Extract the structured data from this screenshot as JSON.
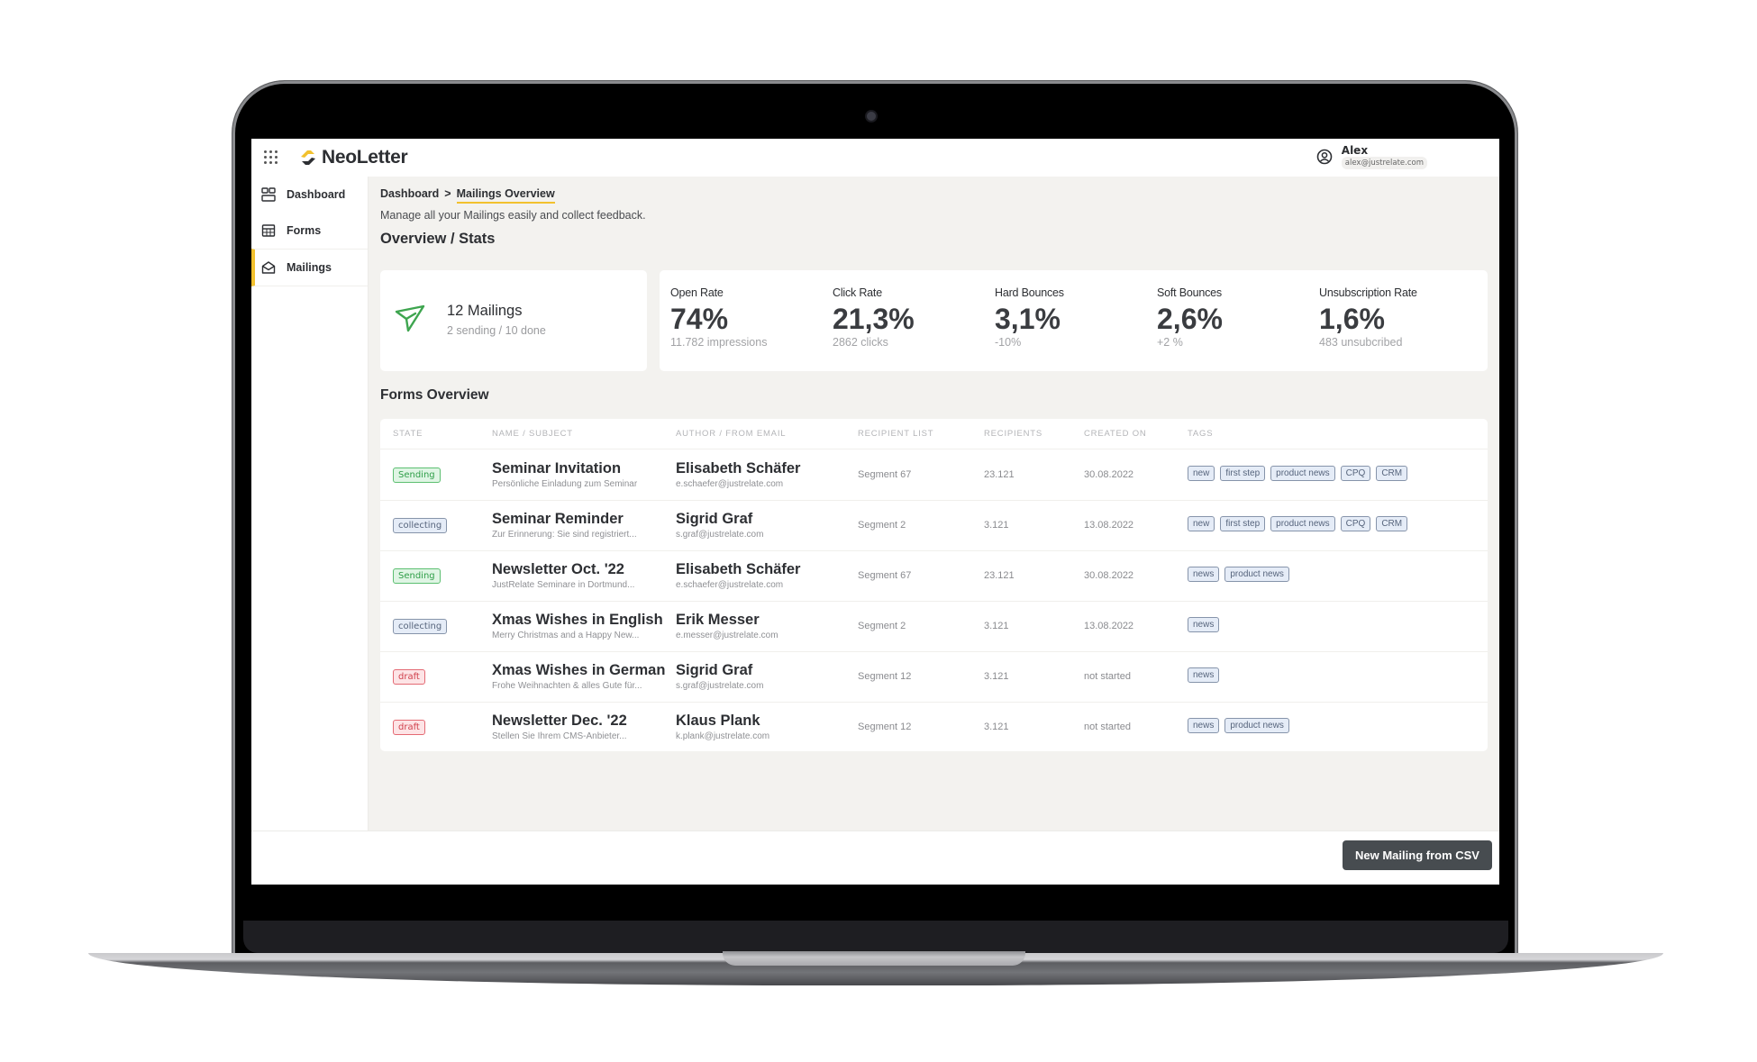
{
  "app": {
    "name": "NeoLetter",
    "brand_color": "#f2c12e"
  },
  "user": {
    "name": "Alex",
    "email": "alex@justrelate.com"
  },
  "sidebar": {
    "items": [
      {
        "label": "Dashboard",
        "icon": "dashboard-icon",
        "active": false
      },
      {
        "label": "Forms",
        "icon": "table-icon",
        "active": false
      },
      {
        "label": "Mailings",
        "icon": "envelope-open-icon",
        "active": true
      }
    ]
  },
  "breadcrumb": {
    "root": "Dashboard",
    "separator": ">",
    "current": "Mailings Overview"
  },
  "page": {
    "subtitle": "Manage all your Mailings easily and collect feedback."
  },
  "overview": {
    "heading": "Overview / Stats",
    "mailings": {
      "count_label": "12 Mailings",
      "status": "2 sending / 10 done"
    },
    "stats": [
      {
        "label": "Open Rate",
        "value": "74%",
        "sub": "11.782 impressions"
      },
      {
        "label": "Click Rate",
        "value": "21,3%",
        "sub": "2862 clicks"
      },
      {
        "label": "Hard Bounces",
        "value": "3,1%",
        "sub": "-10%"
      },
      {
        "label": "Soft Bounces",
        "value": "2,6%",
        "sub": "+2 %"
      },
      {
        "label": "Unsubscription Rate",
        "value": "1,6%",
        "sub": "483 unsubcribed"
      }
    ]
  },
  "forms": {
    "heading": "Forms Overview",
    "columns": [
      "STATE",
      "NAME / SUBJECT",
      "AUTHOR / FROM EMAIL",
      "RECIPIENT LIST",
      "RECIPIENTS",
      "CREATED ON",
      "TAGS"
    ],
    "rows": [
      {
        "state": "Sending",
        "state_type": "sending",
        "name": "Seminar Invitation",
        "subject": "Persönliche Einladung zum Seminar",
        "author": "Elisabeth Schäfer",
        "email": "e.schaefer@justrelate.com",
        "list": "Segment 67",
        "recipients": "23.121",
        "created": "30.08.2022",
        "tags": [
          "new",
          "first step",
          "product news",
          "CPQ",
          "CRM"
        ]
      },
      {
        "state": "collecting",
        "state_type": "collecting",
        "name": "Seminar Reminder",
        "subject": "Zur Erinnerung: Sie sind registriert...",
        "author": "Sigrid Graf",
        "email": "s.graf@justrelate.com",
        "list": "Segment 2",
        "recipients": "3.121",
        "created": "13.08.2022",
        "tags": [
          "new",
          "first step",
          "product news",
          "CPQ",
          "CRM"
        ]
      },
      {
        "state": "Sending",
        "state_type": "sending",
        "name": "Newsletter Oct. '22",
        "subject": "JustRelate Seminare in Dortmund...",
        "author": "Elisabeth Schäfer",
        "email": "e.schaefer@justrelate.com",
        "list": "Segment 67",
        "recipients": "23.121",
        "created": "30.08.2022",
        "tags": [
          "news",
          "product news"
        ]
      },
      {
        "state": "collecting",
        "state_type": "collecting",
        "name": "Xmas Wishes in English",
        "subject": "Merry Christmas and a Happy New...",
        "author": "Erik Messer",
        "email": "e.messer@justrelate.com",
        "list": "Segment 2",
        "recipients": "3.121",
        "created": "13.08.2022",
        "tags": [
          "news"
        ]
      },
      {
        "state": "draft",
        "state_type": "draft",
        "name": "Xmas Wishes in German",
        "subject": "Frohe Weihnachten & alles Gute für...",
        "author": "Sigrid Graf",
        "email": "s.graf@justrelate.com",
        "list": "Segment 12",
        "recipients": "3.121",
        "created": "not started",
        "tags": [
          "news"
        ]
      },
      {
        "state": "draft",
        "state_type": "draft",
        "name": "Newsletter Dec. '22",
        "subject": "Stellen Sie Ihrem CMS-Anbieter...",
        "author": "Klaus Plank",
        "email": "k.plank@justrelate.com",
        "list": "Segment 12",
        "recipients": "3.121",
        "created": "not started",
        "tags": [
          "news",
          "product news"
        ]
      }
    ]
  },
  "footer": {
    "new_mailing_button": "New Mailing from CSV"
  }
}
